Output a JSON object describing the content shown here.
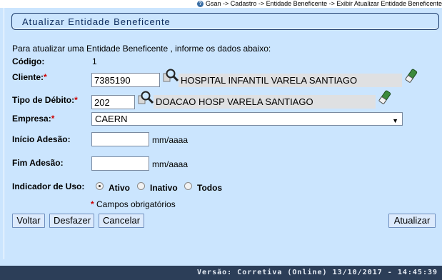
{
  "breadcrumb": "Gsan -> Cadastro -> Entidade Beneficente -> Exibir Atualizar Entidade Beneficente",
  "title": "Atualizar Entidade Beneficente",
  "instructions": "Para atualizar uma Entidade Beneficente , informe os dados abaixo:",
  "codigo": {
    "label": "Código:",
    "value": "1"
  },
  "cliente": {
    "label": "Cliente:",
    "required": "*",
    "code": "7385190",
    "name": "HOSPITAL INFANTIL VARELA SANTIAGO"
  },
  "tipo_debito": {
    "label": "Tipo de Débito:",
    "required": "*",
    "code": "202",
    "name": "DOACAO HOSP VARELA SANTIAGO"
  },
  "empresa": {
    "label": "Empresa:",
    "required": "*",
    "selected": "CAERN"
  },
  "inicio_adesao": {
    "label": "Início Adesão:",
    "value": "",
    "hint": "mm/aaaa"
  },
  "fim_adesao": {
    "label": "Fim Adesão:",
    "value": "",
    "hint": "mm/aaaa"
  },
  "indicador_uso": {
    "label": "Indicador de Uso:",
    "options": [
      "Ativo",
      "Inativo",
      "Todos"
    ],
    "selected": "Ativo"
  },
  "required_note": {
    "star": "*",
    "text": "Campos obrigatórios"
  },
  "buttons": {
    "voltar": "Voltar",
    "desfazer": "Desfazer",
    "cancelar": "Cancelar",
    "atualizar": "Atualizar"
  },
  "footer": "Versão: Corretiva (Online) 13/10/2017 - 14:45:39",
  "colors": {
    "background": "#cbe5fe",
    "footer": "#2c3e58",
    "required": "#cc0000"
  }
}
